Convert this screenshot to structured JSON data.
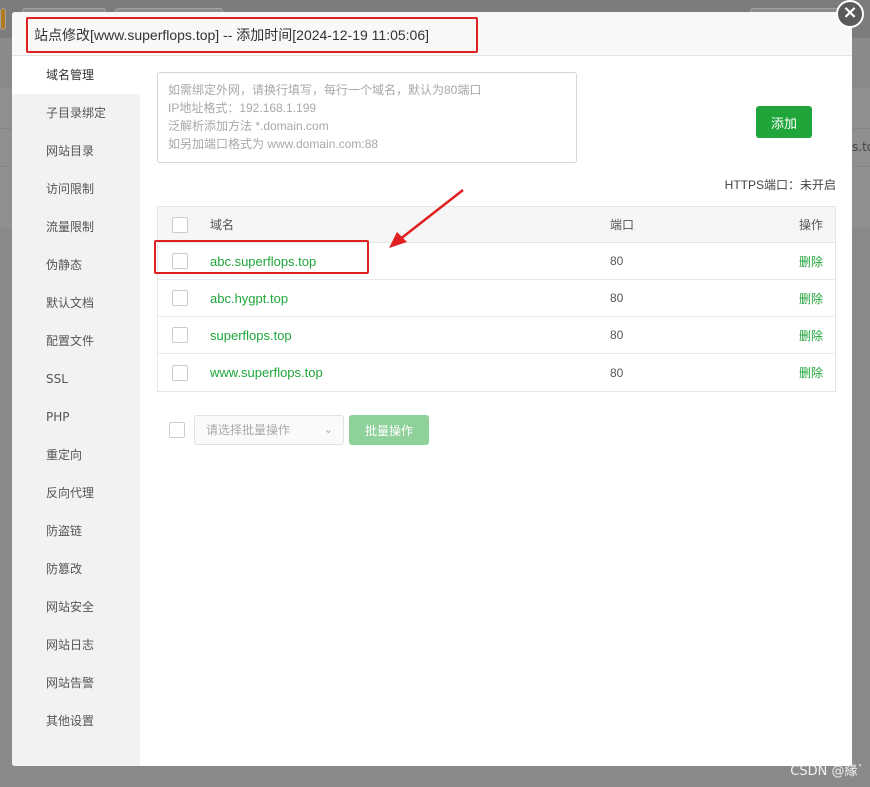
{
  "modal": {
    "title": "站点修改[www.superflops.top] -- 添加时间[2024-12-19 11:05:06]",
    "close_symbol": "×"
  },
  "sidebar": {
    "items": [
      {
        "label": "域名管理"
      },
      {
        "label": "子目录绑定"
      },
      {
        "label": "网站目录"
      },
      {
        "label": "访问限制"
      },
      {
        "label": "流量限制"
      },
      {
        "label": "伪静态"
      },
      {
        "label": "默认文档"
      },
      {
        "label": "配置文件"
      },
      {
        "label": "SSL"
      },
      {
        "label": "PHP"
      },
      {
        "label": "重定向"
      },
      {
        "label": "反向代理"
      },
      {
        "label": "防盗链"
      },
      {
        "label": "防篡改"
      },
      {
        "label": "网站安全"
      },
      {
        "label": "网站日志"
      },
      {
        "label": "网站告警"
      },
      {
        "label": "其他设置"
      }
    ]
  },
  "domain_input": {
    "placeholder_lines": [
      "如需绑定外网，请换行填写，每行一个域名，默认为80端口",
      "IP地址格式：192.168.1.199",
      "泛解析添加方法 *.domain.com",
      "如另加端口格式为 www.domain.com:88"
    ]
  },
  "add_button": "添加",
  "https_status": "HTTPS端口：未开启",
  "table": {
    "headers": {
      "domain": "域名",
      "port": "端口",
      "operation": "操作"
    },
    "rows": [
      {
        "domain": "abc.superflops.top",
        "port": "80",
        "action": "删除"
      },
      {
        "domain": "abc.hygpt.top",
        "port": "80",
        "action": "删除"
      },
      {
        "domain": "superflops.top",
        "port": "80",
        "action": "删除"
      },
      {
        "domain": "www.superflops.top",
        "port": "80",
        "action": "删除"
      }
    ]
  },
  "batch": {
    "select_placeholder": "请选择批量操作",
    "button": "批量操作"
  },
  "background_snippet": "s.to",
  "watermark": "CSDN @緣`",
  "colors": {
    "accent": "#20a53a",
    "highlight": "#e02020"
  }
}
